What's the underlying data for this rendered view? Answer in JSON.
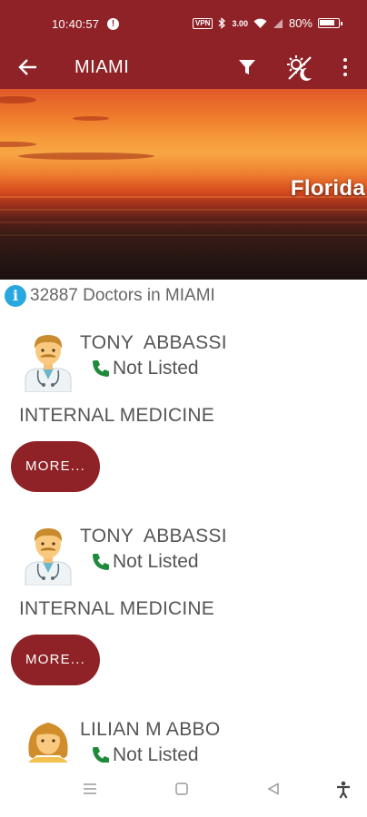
{
  "status_bar": {
    "time": "10:40:57",
    "notification_badge": "!",
    "vpn": "VPN",
    "network_speed": "3.00",
    "battery": "80%"
  },
  "app_bar": {
    "title": "MIAMI",
    "back_icon": "arrow-left-icon",
    "filter_icon": "filter-icon",
    "theme_icon": "day-night-icon",
    "more_icon": "more-vert-icon"
  },
  "hero": {
    "label": "Florida"
  },
  "summary": {
    "info_symbol": "i",
    "text": "32887 Doctors in MIAMI"
  },
  "doctors": [
    {
      "name": "TONY  ABBASSI",
      "phone": "Not Listed",
      "specialty": "INTERNAL MEDICINE",
      "more_label": "MORE...",
      "avatar": "male-doctor-avatar"
    },
    {
      "name": "TONY  ABBASSI",
      "phone": "Not Listed",
      "specialty": "INTERNAL MEDICINE",
      "more_label": "MORE...",
      "avatar": "male-doctor-avatar"
    },
    {
      "name": "LILIAN M ABBO",
      "phone": "Not Listed",
      "specialty": "",
      "more_label": "",
      "avatar": "female-avatar"
    }
  ],
  "colors": {
    "primary": "#8f2226",
    "info": "#29a8e0",
    "phone": "#1e8a3c",
    "text": "#555555"
  }
}
